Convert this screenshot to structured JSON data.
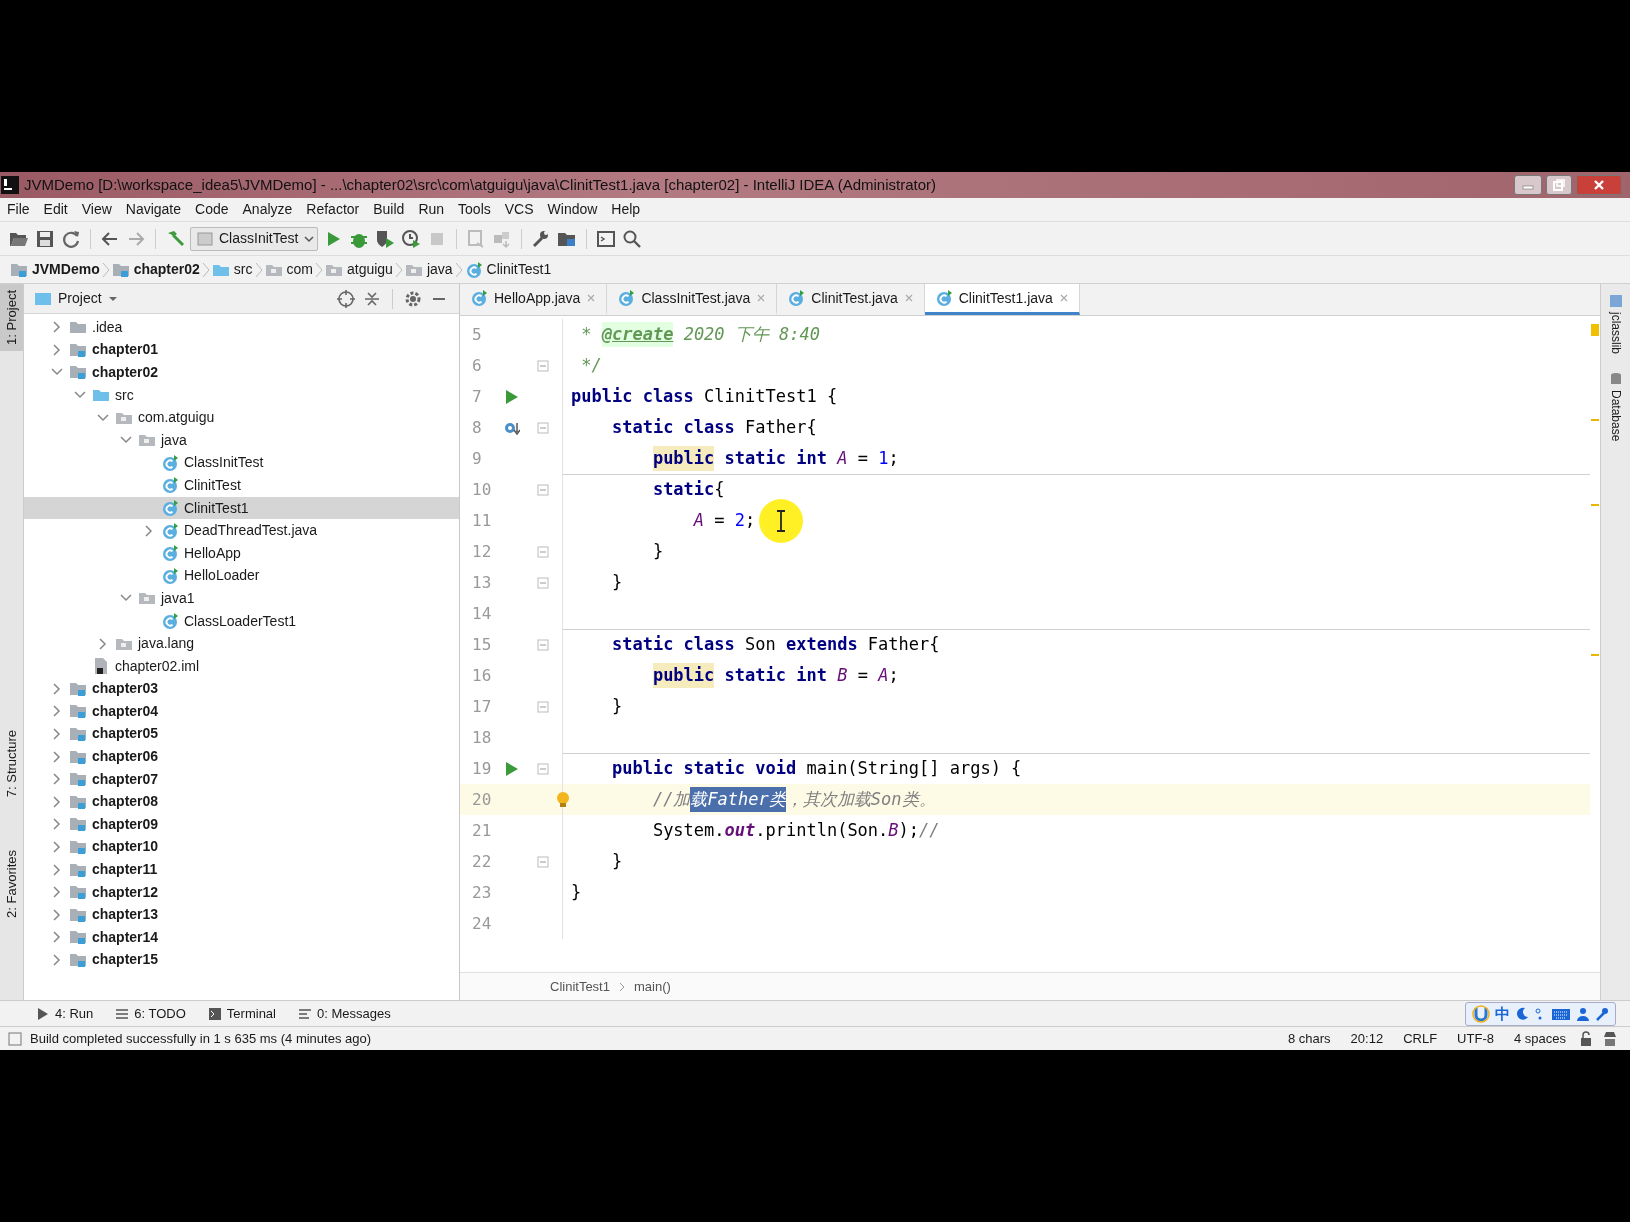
{
  "window": {
    "title": "JVMDemo [D:\\workspace_idea5\\JVMDemo] - ...\\chapter02\\src\\com\\atguigu\\java\\ClinitTest1.java [chapter02] - IntelliJ IDEA (Administrator)"
  },
  "menu": [
    "File",
    "Edit",
    "View",
    "Navigate",
    "Code",
    "Analyze",
    "Refactor",
    "Build",
    "Run",
    "Tools",
    "VCS",
    "Window",
    "Help"
  ],
  "toolbar": {
    "run_config": "ClassInitTest"
  },
  "breadcrumbs": [
    {
      "label": "JVMDemo",
      "kind": "module"
    },
    {
      "label": "chapter02",
      "kind": "module"
    },
    {
      "label": "src",
      "kind": "source"
    },
    {
      "label": "com",
      "kind": "package"
    },
    {
      "label": "atguigu",
      "kind": "package"
    },
    {
      "label": "java",
      "kind": "package"
    },
    {
      "label": "ClinitTest1",
      "kind": "class"
    }
  ],
  "left_tool_tabs": [
    {
      "label": "1: Project",
      "selected": true
    },
    {
      "label": "7: Structure",
      "selected": false
    },
    {
      "label": "2: Favorites",
      "selected": false
    }
  ],
  "project_panel": {
    "title": "Project",
    "tree": [
      {
        "label": ".idea",
        "kind": "folder",
        "expanded": false,
        "selected": false
      },
      {
        "label": "chapter01",
        "kind": "module",
        "expanded": false,
        "selected": false
      },
      {
        "label": "chapter02",
        "kind": "module",
        "expanded": true,
        "selected": false,
        "children": [
          {
            "label": "src",
            "kind": "source",
            "expanded": true,
            "selected": false,
            "children": [
              {
                "label": "com.atguigu",
                "kind": "package",
                "expanded": true,
                "selected": false,
                "children": [
                  {
                    "label": "java",
                    "kind": "package",
                    "expanded": true,
                    "selected": false,
                    "children": [
                      {
                        "label": "ClassInitTest",
                        "kind": "class",
                        "selected": false
                      },
                      {
                        "label": "ClinitTest",
                        "kind": "class",
                        "selected": false
                      },
                      {
                        "label": "ClinitTest1",
                        "kind": "class",
                        "selected": true
                      },
                      {
                        "label": "DeadThreadTest.java",
                        "kind": "class",
                        "expanded": false,
                        "selected": false
                      },
                      {
                        "label": "HelloApp",
                        "kind": "class",
                        "selected": false
                      },
                      {
                        "label": "HelloLoader",
                        "kind": "class",
                        "selected": false
                      }
                    ]
                  },
                  {
                    "label": "java1",
                    "kind": "package",
                    "expanded": true,
                    "selected": false,
                    "children": [
                      {
                        "label": "ClassLoaderTest1",
                        "kind": "class",
                        "selected": false
                      }
                    ]
                  }
                ]
              },
              {
                "label": "java.lang",
                "kind": "package",
                "expanded": false,
                "selected": false
              }
            ]
          },
          {
            "label": "chapter02.iml",
            "kind": "iml",
            "selected": false
          }
        ]
      },
      {
        "label": "chapter03",
        "kind": "module",
        "expanded": false,
        "selected": false
      },
      {
        "label": "chapter04",
        "kind": "module",
        "expanded": false,
        "selected": false
      },
      {
        "label": "chapter05",
        "kind": "module",
        "expanded": false,
        "selected": false
      },
      {
        "label": "chapter06",
        "kind": "module",
        "expanded": false,
        "selected": false
      },
      {
        "label": "chapter07",
        "kind": "module",
        "expanded": false,
        "selected": false
      },
      {
        "label": "chapter08",
        "kind": "module",
        "expanded": false,
        "selected": false
      },
      {
        "label": "chapter09",
        "kind": "module",
        "expanded": false,
        "selected": false
      },
      {
        "label": "chapter10",
        "kind": "module",
        "expanded": false,
        "selected": false
      },
      {
        "label": "chapter11",
        "kind": "module",
        "expanded": false,
        "selected": false
      },
      {
        "label": "chapter12",
        "kind": "module",
        "expanded": false,
        "selected": false
      },
      {
        "label": "chapter13",
        "kind": "module",
        "expanded": false,
        "selected": false
      },
      {
        "label": "chapter14",
        "kind": "module",
        "expanded": false,
        "selected": false
      },
      {
        "label": "chapter15",
        "kind": "module",
        "expanded": false,
        "selected": false
      }
    ]
  },
  "editor_tabs": [
    {
      "label": "HelloApp.java",
      "selected": false
    },
    {
      "label": "ClassInitTest.java",
      "selected": false
    },
    {
      "label": "ClinitTest.java",
      "selected": false
    },
    {
      "label": "ClinitTest1.java",
      "selected": true
    }
  ],
  "code_lines": [
    {
      "number": "5",
      "tokens": [
        {
          "kind": "doc",
          "text": " * "
        },
        {
          "kind": "tag",
          "text": "@create"
        },
        {
          "kind": "doc",
          "text": " 2020 下午 8:40"
        }
      ]
    },
    {
      "number": "6",
      "fold": true,
      "tokens": [
        {
          "kind": "doc",
          "text": " */"
        }
      ]
    },
    {
      "number": "7",
      "runnable": true,
      "tokens": [
        {
          "kind": "kw",
          "text": "public class "
        },
        {
          "kind": "plain",
          "text": "ClinitTest1 {"
        }
      ]
    },
    {
      "number": "8",
      "overrides": true,
      "fold": true,
      "tokens": [
        {
          "kind": "kw",
          "text": "    static class "
        },
        {
          "kind": "plain",
          "text": "Father{"
        }
      ]
    },
    {
      "number": "9",
      "tokens": [
        {
          "kind": "kw-warn",
          "text": "        public"
        },
        {
          "kind": "kw",
          "text": " static int "
        },
        {
          "kind": "field",
          "text": "A"
        },
        {
          "kind": "plain",
          "text": " = "
        },
        {
          "kind": "num",
          "text": "1"
        },
        {
          "kind": "plain",
          "text": ";"
        }
      ]
    },
    {
      "number": "10",
      "fold": true,
      "separator": true,
      "tokens": [
        {
          "kind": "kw",
          "text": "        static"
        },
        {
          "kind": "plain",
          "text": "{"
        }
      ]
    },
    {
      "number": "11",
      "cursor": true,
      "tokens": [
        {
          "kind": "field",
          "text": "            A"
        },
        {
          "kind": "plain",
          "text": " = "
        },
        {
          "kind": "num",
          "text": "2"
        },
        {
          "kind": "plain",
          "text": ";"
        }
      ]
    },
    {
      "number": "12",
      "fold": true,
      "tokens": [
        {
          "kind": "plain",
          "text": "        }"
        }
      ]
    },
    {
      "number": "13",
      "fold": true,
      "tokens": [
        {
          "kind": "plain",
          "text": "    }"
        }
      ]
    },
    {
      "number": "14"
    },
    {
      "number": "15",
      "fold": true,
      "separator": true,
      "tokens": [
        {
          "kind": "kw",
          "text": "    static class "
        },
        {
          "kind": "plain",
          "text": "Son "
        },
        {
          "kind": "kw",
          "text": "extends "
        },
        {
          "kind": "plain",
          "text": "Father{"
        }
      ]
    },
    {
      "number": "16",
      "tokens": [
        {
          "kind": "kw-warn",
          "text": "        public"
        },
        {
          "kind": "kw",
          "text": " static int "
        },
        {
          "kind": "field",
          "text": "B"
        },
        {
          "kind": "plain",
          "text": " = "
        },
        {
          "kind": "field",
          "text": "A"
        },
        {
          "kind": "plain",
          "text": ";"
        }
      ]
    },
    {
      "number": "17",
      "fold": true,
      "tokens": [
        {
          "kind": "plain",
          "text": "    }"
        }
      ]
    },
    {
      "number": "18"
    },
    {
      "number": "19",
      "runnable": true,
      "fold": true,
      "separator": true,
      "tokens": [
        {
          "kind": "kw",
          "text": "    public static void "
        },
        {
          "kind": "plain",
          "text": "main(String[] args) {"
        }
      ]
    },
    {
      "number": "20",
      "intention_bulb": true,
      "current": true,
      "tokens": [
        {
          "kind": "comment",
          "text": "        //加"
        },
        {
          "kind": "comment-sel",
          "text": "载Father类"
        },
        {
          "kind": "comment",
          "text": "，其次加载Son类。"
        }
      ]
    },
    {
      "number": "21",
      "tokens": [
        {
          "kind": "plain",
          "text": "        System."
        },
        {
          "kind": "static-field",
          "text": "out"
        },
        {
          "kind": "plain",
          "text": ".println(Son."
        },
        {
          "kind": "field",
          "text": "B"
        },
        {
          "kind": "plain",
          "text": ");"
        },
        {
          "kind": "comment",
          "text": "//"
        }
      ]
    },
    {
      "number": "22",
      "fold": true,
      "tokens": [
        {
          "kind": "plain",
          "text": "    }"
        }
      ]
    },
    {
      "number": "23",
      "tokens": [
        {
          "kind": "plain",
          "text": "}"
        }
      ]
    },
    {
      "number": "24"
    }
  ],
  "editor_breadcrumbs": [
    "ClinitTest1",
    "main()"
  ],
  "right_tool_tabs": [
    "jclasslib",
    "Database"
  ],
  "bottom_tool_tabs": [
    {
      "label": "4: Run",
      "kind": "run"
    },
    {
      "label": "6: TODO",
      "kind": "todo"
    },
    {
      "label": "Terminal",
      "kind": "terminal"
    },
    {
      "label": "0: Messages",
      "kind": "messages"
    }
  ],
  "ime_bar": {
    "label": "中"
  },
  "status_bar": {
    "message": "Build completed successfully in 1 s 635 ms (4 minutes ago)",
    "items": [
      "8 chars",
      "20:12",
      "CRLF",
      "UTF-8",
      "4 spaces"
    ]
  }
}
